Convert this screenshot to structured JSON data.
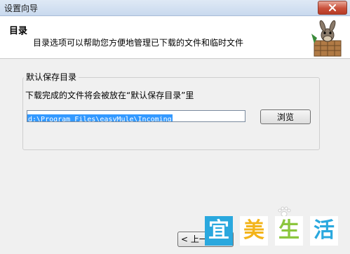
{
  "window": {
    "title": "设置向导"
  },
  "header": {
    "title": "目录",
    "description": "目录选项可以帮助您方便地管理已下载的文件和临时文件"
  },
  "group": {
    "legend": "默认保存目录",
    "instruction": "下载完成的文件将会被放在“默认保存目录”里",
    "path_value": "d:\\Program Files\\easyMule\\Incoming",
    "browse_label": "浏览"
  },
  "footer": {
    "back_label": "< 上一步"
  },
  "watermark": {
    "chars": [
      "宜",
      "美",
      "生",
      "活"
    ]
  },
  "colors": {
    "selection": "#3399ff",
    "close_button": "#c9503a",
    "watermark_text": "#d4009a",
    "watermark_tiles": [
      "#2aa8de",
      "#f3b41a",
      "#8cc63e",
      "#2aa8de"
    ]
  },
  "icons": {
    "close": "close-icon",
    "mascot": "easymule-mascot-icon",
    "paw": "paw-icon"
  }
}
